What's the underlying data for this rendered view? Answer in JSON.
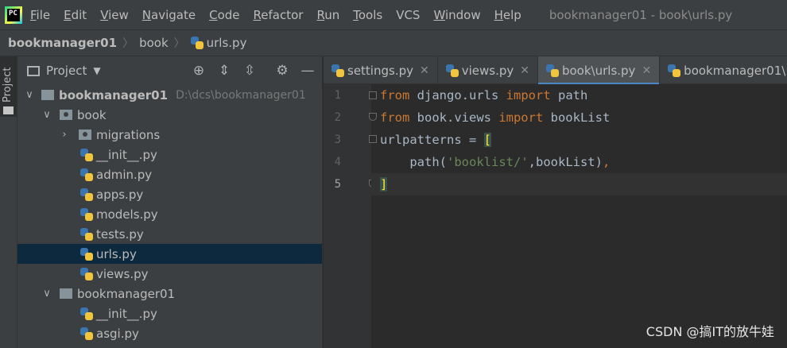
{
  "menubar": {
    "logo_text": "PC",
    "items": [
      {
        "mn": "F",
        "rest": "ile"
      },
      {
        "mn": "E",
        "rest": "dit"
      },
      {
        "mn": "V",
        "rest": "iew"
      },
      {
        "mn": "N",
        "rest": "avigate"
      },
      {
        "mn": "C",
        "rest": "ode"
      },
      {
        "mn": "R",
        "rest": "efactor"
      },
      {
        "mn": "R",
        "rest": "un",
        "pre": ""
      },
      {
        "mn": "T",
        "rest": "ools"
      },
      {
        "mn": "",
        "rest": "VCS"
      },
      {
        "mn": "W",
        "rest": "indow"
      },
      {
        "mn": "H",
        "rest": "elp"
      }
    ],
    "window_title": "bookmanager01 - book\\urls.py"
  },
  "breadcrumb": {
    "project": "bookmanager01",
    "folder": "book",
    "file": "urls.py"
  },
  "left_strip": {
    "tab_label": "Project"
  },
  "project_panel": {
    "title": "Project",
    "tree": [
      {
        "label": "bookmanager01",
        "path": "D:\\dcs\\bookmanager01",
        "type": "folder",
        "level": 0,
        "expanded": true,
        "bold": true
      },
      {
        "label": "book",
        "type": "folder",
        "level": 1,
        "expanded": true
      },
      {
        "label": "migrations",
        "type": "folder",
        "level": 2,
        "expanded": false
      },
      {
        "label": "__init__.py",
        "type": "py",
        "level": 2
      },
      {
        "label": "admin.py",
        "type": "py",
        "level": 2
      },
      {
        "label": "apps.py",
        "type": "py",
        "level": 2
      },
      {
        "label": "models.py",
        "type": "py",
        "level": 2
      },
      {
        "label": "tests.py",
        "type": "py",
        "level": 2
      },
      {
        "label": "urls.py",
        "type": "py",
        "level": 2,
        "selected": true
      },
      {
        "label": "views.py",
        "type": "py",
        "level": 2
      },
      {
        "label": "bookmanager01",
        "type": "folder",
        "level": 1,
        "expanded": true
      },
      {
        "label": "__init__.py",
        "type": "py",
        "level": 2
      },
      {
        "label": "asgi.py",
        "type": "py",
        "level": 2
      }
    ]
  },
  "editor": {
    "tabs": [
      {
        "label": "settings.py",
        "active": false
      },
      {
        "label": "views.py",
        "active": false
      },
      {
        "label": "book\\urls.py",
        "active": true
      },
      {
        "label": "bookmanager01\\",
        "active": false
      }
    ],
    "line_numbers": [
      "1",
      "2",
      "3",
      "4",
      "5"
    ],
    "code": {
      "l1_kw1": "from",
      "l1_mod": " django.urls ",
      "l1_kw2": "import",
      "l1_name": " path",
      "l2_kw1": "from",
      "l2_mod": " book.views ",
      "l2_kw2": "import",
      "l2_name": " bookList",
      "l3_name": "urlpatterns = ",
      "l3_br": "[",
      "l4_pre": "    path(",
      "l4_str": "'booklist/'",
      "l4_post": ",bookList)",
      "l4_comma": ",",
      "l5_br": "]"
    }
  },
  "watermark": "CSDN @搞IT的放牛娃",
  "colors": {
    "keyword": "#cc7832",
    "string": "#6a8759",
    "text": "#a9b7c6",
    "selection": "#0d293e",
    "tab_underline": "#4a88c7"
  }
}
